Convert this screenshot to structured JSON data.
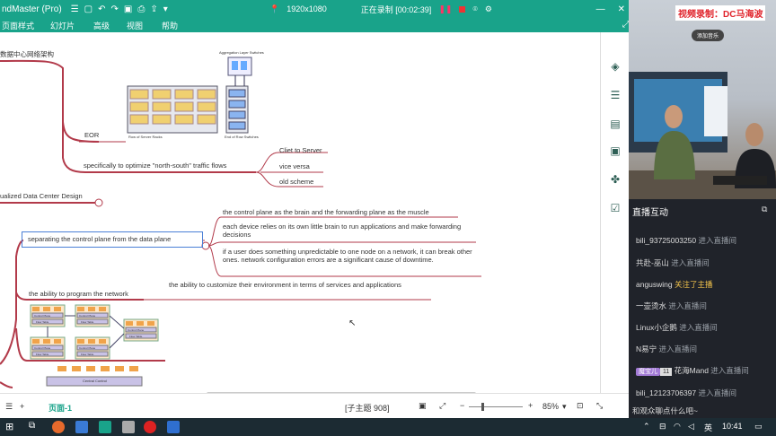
{
  "titlebar": {
    "app_title": "ndMaster (Pro)",
    "resolution": "1920x1080",
    "recording": "正在录制 [00:02:39]",
    "login": "登录"
  },
  "menu": [
    "页面样式",
    "幻灯片",
    "高级",
    "视图",
    "帮助"
  ],
  "canvas": {
    "branch1": "数据中心网络架构",
    "eor": "EOR",
    "figure1_top": "Aggregation Layer Switches",
    "figure1_left": "Row of Server Racks",
    "figure1_right": "End of Row Switches",
    "spec": "specifically to optimize  \"north-south\"  traffic flows",
    "client_server": "Cliet to Server",
    "vice_versa": "vice versa",
    "old_scheme": "old scheme",
    "vdc": "ualized Data Center Design",
    "separating": "separating the control plane from the data plane",
    "cp_brain": "the control plane as the brain and the forwarding plane as the muscle",
    "each_device": "each device relies on its own little brain to run applications and make forwarding decisions",
    "if_user": "if a user does something unpredictable to one node on a network, it can break other ones. network configuration errors are a significant cause of downtime.",
    "program": "the ability to program the network",
    "customize": "the ability to customize their environment in terms of services and applications",
    "fig_app": "App",
    "fig_control_plane": "Control Plane",
    "fig_flow_table": "Flow Table",
    "fig_central_control": "Central Control"
  },
  "status": {
    "page_tab": "页面-1",
    "subtopic": "[子主题 908]",
    "zoom": "85%"
  },
  "stream": {
    "video_title": "视频录制：DC马海波",
    "add_music": "添加音乐",
    "header": "直播互动",
    "chat": [
      {
        "name": "bili_93725003250",
        "msg": "进入直播间"
      },
      {
        "name": "共赴-巫山",
        "msg": "进入直播间"
      },
      {
        "name": "anguswing",
        "msg": "关注了主播",
        "follow": true
      },
      {
        "name": "一壶烫水",
        "msg": "进入直播间"
      },
      {
        "name": "Linux小企鹅",
        "msg": "进入直播间"
      },
      {
        "name": "N易宁",
        "msg": "进入直播间"
      },
      {
        "name": "花海Mand",
        "msg": "进入直播间",
        "badge": "魔宝儿",
        "level": "11"
      },
      {
        "name": "bili_12123706397",
        "msg": "进入直播间"
      }
    ],
    "input_hint": "和观众聊点什么吧~"
  },
  "taskbar": {
    "ime": "英",
    "time": "10:41"
  }
}
